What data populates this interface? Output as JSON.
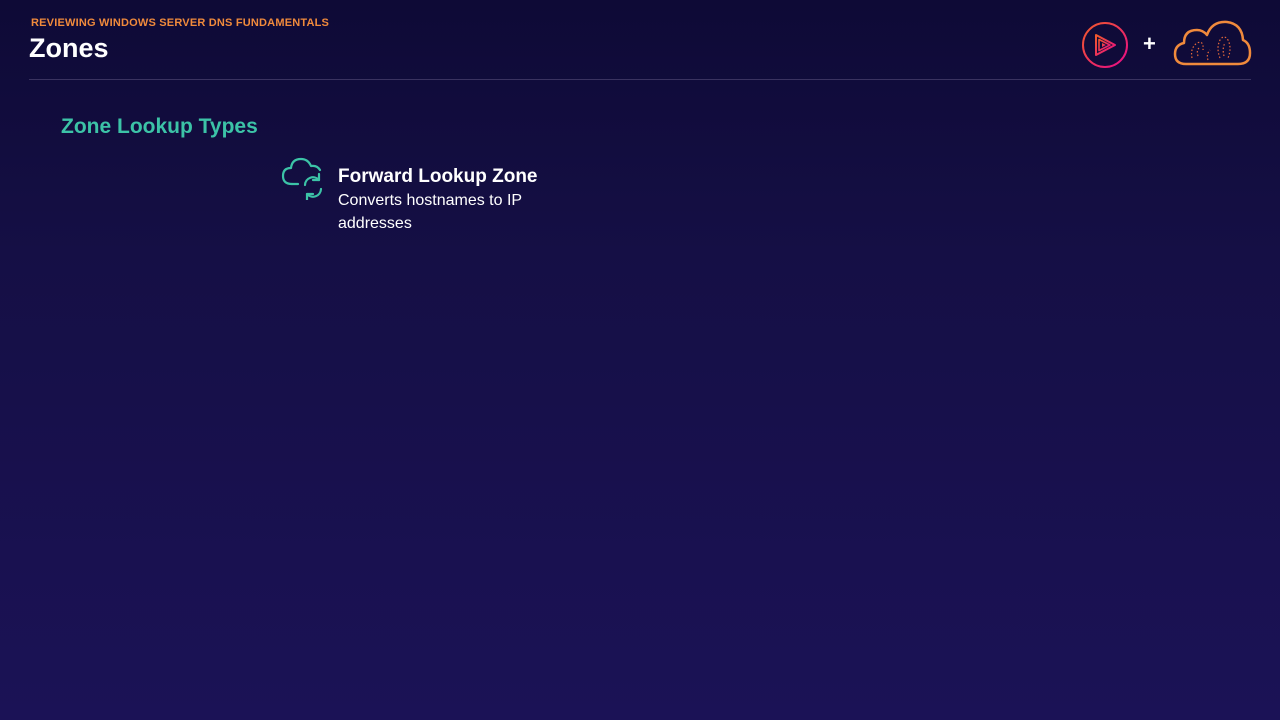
{
  "header": {
    "kicker": "REVIEWING WINDOWS SERVER DNS FUNDAMENTALS",
    "title": "Zones",
    "logos": {
      "plus": "+",
      "left_logo_icon": "play-logo-icon",
      "right_logo_icon": "cloud-logo-icon"
    }
  },
  "main": {
    "section_title": "Zone Lookup Types",
    "items": [
      {
        "icon": "cloud-sync-icon",
        "title": "Forward Lookup Zone",
        "description": "Converts hostnames to IP addresses"
      }
    ]
  },
  "colors": {
    "accent_orange": "#f08a3c",
    "accent_teal": "#3cc3a7",
    "accent_pink": "#e8335d",
    "background_top": "#0e0a36",
    "background_bottom": "#1b1256"
  }
}
